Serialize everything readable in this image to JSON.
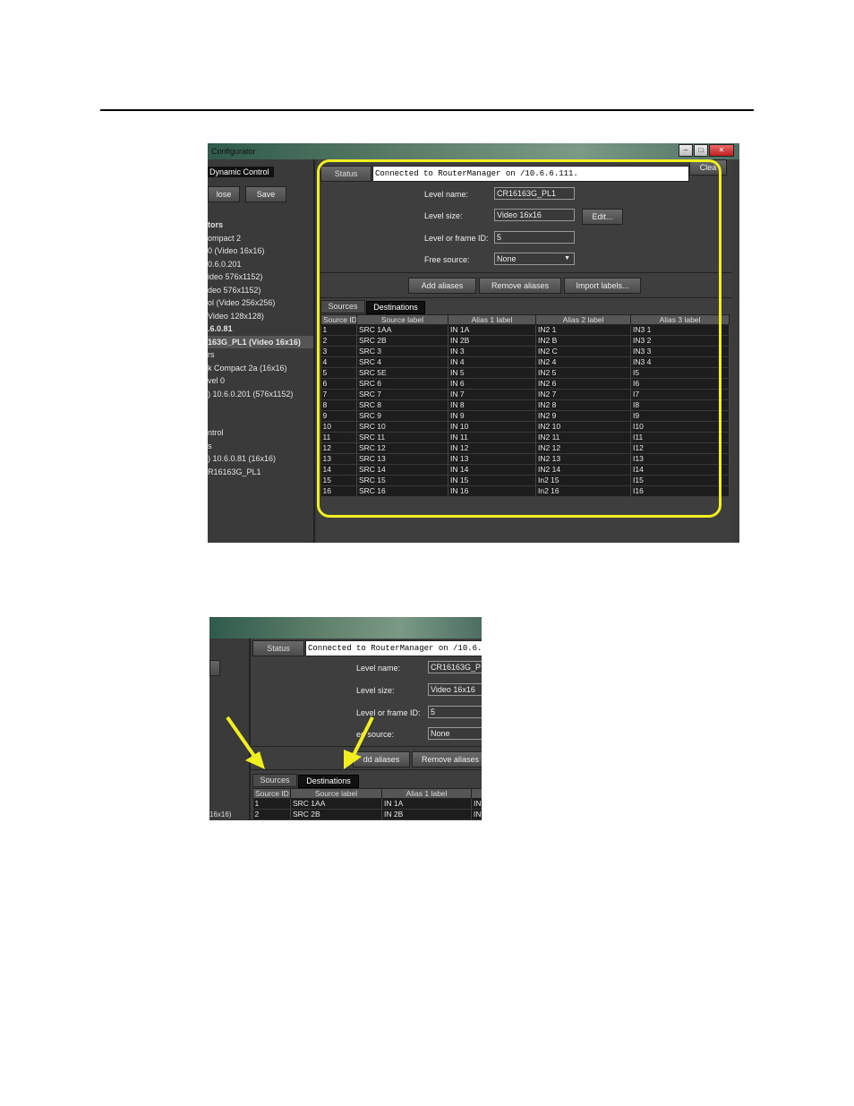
{
  "window_title": "Configurator",
  "left_panel": {
    "tab_label": "Dynamic Control",
    "close_label": "lose",
    "save_label": "Save",
    "items": [
      {
        "label": "tors",
        "bold": true
      },
      {
        "label": "ompact 2",
        "bold": false
      },
      {
        "label": "0 (Video 16x16)",
        "bold": false
      },
      {
        "label": "0.6.0.201",
        "bold": false
      },
      {
        "label": "ideo 576x1152)",
        "bold": false
      },
      {
        "label": "deo 576x1152)",
        "bold": false
      },
      {
        "label": "ol (Video 256x256)",
        "bold": false
      },
      {
        "label": "Video 128x128)",
        "bold": false
      },
      {
        "label": ".6.0.81",
        "bold": true
      },
      {
        "label": "163G_PL1 (Video 16x16)",
        "bold": true,
        "selected": true
      },
      {
        "label": "rs",
        "bold": false
      },
      {
        "label": "k Compact 2a (16x16)",
        "bold": false
      },
      {
        "label": "vel 0",
        "bold": false
      },
      {
        "label": ") 10.6.0.201 (576x1152)",
        "bold": false
      },
      {
        "label": "",
        "bold": false
      },
      {
        "label": "",
        "bold": false
      },
      {
        "label": "ntrol",
        "bold": false
      },
      {
        "label": "s",
        "bold": false
      },
      {
        "label": ") 10.6.0.81 (16x16)",
        "bold": false
      },
      {
        "label": "R16163G_PL1",
        "bold": false
      }
    ]
  },
  "status": {
    "label": "Status",
    "value": "Connected to RouterManager on /10.6.6.111.",
    "clear_label": "Clea"
  },
  "form": {
    "level_name_label": "Level name:",
    "level_name_value": "CR16163G_PL1",
    "level_size_label": "Level size:",
    "level_size_value": "Video 16x16",
    "edit_label": "Edit...",
    "level_id_label": "Level or frame ID:",
    "level_id_value": "5",
    "free_source_label": "Free source:",
    "free_source_value": "None"
  },
  "actions": {
    "add_aliases": "Add aliases",
    "remove_aliases": "Remove aliases",
    "import_labels": "Import labels..."
  },
  "tabs": {
    "sources": "Sources",
    "destinations": "Destinations"
  },
  "table": {
    "columns": [
      "Source ID",
      "Source label",
      "Alias 1 label",
      "Alias 2 label",
      "Alias 3 label"
    ],
    "rows": [
      [
        "1",
        "SRC 1AA",
        "IN 1A",
        "IN2 1",
        "IN3 1"
      ],
      [
        "2",
        "SRC 2B",
        "IN 2B",
        "IN2 B",
        "IN3 2"
      ],
      [
        "3",
        "SRC 3",
        "IN 3",
        "IN2 C",
        "IN3 3"
      ],
      [
        "4",
        "SRC 4",
        "IN 4",
        "IN2 4",
        "IN3 4"
      ],
      [
        "5",
        "SRC 5E",
        "IN 5",
        "IN2 5",
        "I5"
      ],
      [
        "6",
        "SRC 6",
        "IN 6",
        "IN2 6",
        "I6"
      ],
      [
        "7",
        "SRC 7",
        "IN 7",
        "IN2 7",
        "I7"
      ],
      [
        "8",
        "SRC 8",
        "IN 8",
        "IN2 8",
        "I8"
      ],
      [
        "9",
        "SRC 9",
        "IN 9",
        "IN2 9",
        "I9"
      ],
      [
        "10",
        "SRC 10",
        "IN 10",
        "IN2 10",
        "I10"
      ],
      [
        "11",
        "SRC 11",
        "IN 11",
        "IN2 11",
        "I11"
      ],
      [
        "12",
        "SRC 12",
        "IN 12",
        "IN2 12",
        "I12"
      ],
      [
        "13",
        "SRC 13",
        "IN 13",
        "IN2 13",
        "I13"
      ],
      [
        "14",
        "SRC 14",
        "IN 14",
        "IN2 14",
        "I14"
      ],
      [
        "15",
        "SRC 15",
        "IN 15",
        "In2 15",
        "I15"
      ],
      [
        "16",
        "SRC 16",
        "IN 16",
        "In2 16",
        "I16"
      ]
    ]
  },
  "zoom": {
    "status_value": "Connected to RouterManager on /10.6.6",
    "level_name_value": "CR16163G_P",
    "level_size_value": "Video 16x16",
    "level_id_label": "Level or frame ID:",
    "free_source_label": "ee source:",
    "add_aliases": "dd aliases",
    "remove_aliases": "Remove aliases",
    "alias1_header": "Alias 1 label",
    "rows": [
      [
        "1",
        "SRC 1AA",
        "IN 1A",
        "IN"
      ],
      [
        "2",
        "SRC 2B",
        "IN 2B",
        "IN"
      ]
    ],
    "left_fragment": "16x16)"
  },
  "colors": {
    "highlight": "#f2ef20",
    "window_bg": "#3b3b3b",
    "grid_bg": "#1d1d1d"
  }
}
